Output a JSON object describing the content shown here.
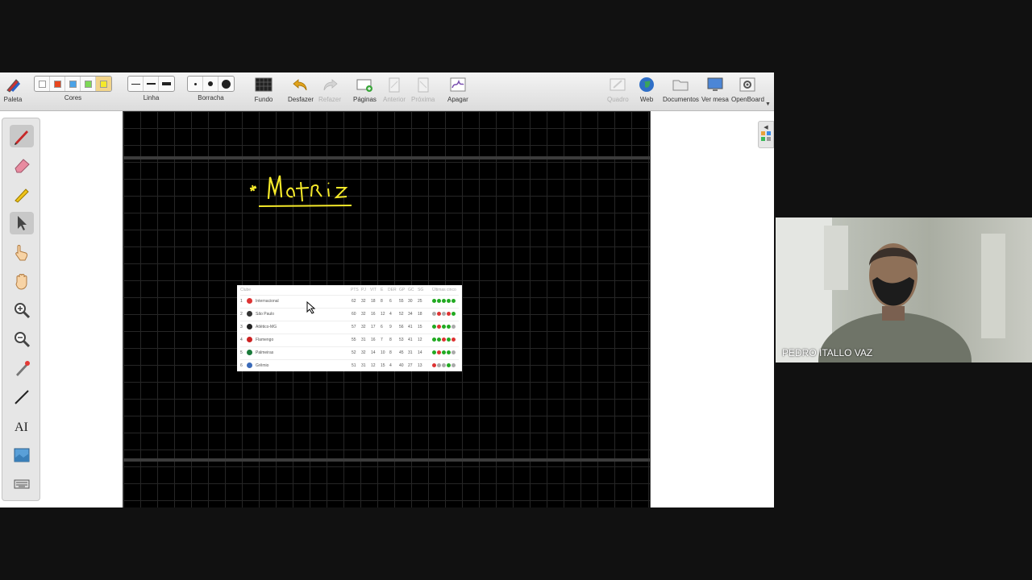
{
  "toolbar": {
    "paleta": "Paleta",
    "cores": "Cores",
    "linha": "Linha",
    "borracha": "Borracha",
    "fundo": "Fundo",
    "desfazer": "Desfazer",
    "refazer": "Refazer",
    "paginas": "Páginas",
    "anterior": "Anterior",
    "proxima": "Próxima",
    "apagar": "Apagar",
    "quadro": "Quadro",
    "web": "Web",
    "documentos": "Documentos",
    "ver_mesa": "Ver mesa",
    "openboard": "OpenBoard"
  },
  "colors": [
    "#ffffff",
    "#e8461e",
    "#4aa3e8",
    "#7ed957",
    "#f5e92a"
  ],
  "board": {
    "handwriting": "* Matriz"
  },
  "standings": {
    "header_label": "Clube",
    "header_cols": [
      "PTS",
      "PJ",
      "VIT",
      "E",
      "DER",
      "GP",
      "GC",
      "SG",
      "Últimas cinco"
    ],
    "rows": [
      {
        "pos": "1",
        "team": "Internacional",
        "badge": "#d33",
        "nums": [
          "62",
          "32",
          "18",
          "8",
          "6",
          "55",
          "30",
          "25"
        ],
        "form": [
          "#2a2",
          "#2a2",
          "#2a2",
          "#2a2",
          "#2a2"
        ]
      },
      {
        "pos": "2",
        "team": "São Paulo",
        "badge": "#333",
        "nums": [
          "60",
          "32",
          "16",
          "12",
          "4",
          "52",
          "34",
          "18"
        ],
        "form": [
          "#aaa",
          "#d33",
          "#aaa",
          "#d33",
          "#2a2"
        ]
      },
      {
        "pos": "3",
        "team": "Atlético-MG",
        "badge": "#222",
        "nums": [
          "57",
          "32",
          "17",
          "6",
          "9",
          "56",
          "41",
          "15"
        ],
        "form": [
          "#2a2",
          "#d33",
          "#2a2",
          "#2a2",
          "#aaa"
        ]
      },
      {
        "pos": "4",
        "team": "Flamengo",
        "badge": "#c22",
        "nums": [
          "55",
          "31",
          "16",
          "7",
          "8",
          "53",
          "41",
          "12"
        ],
        "form": [
          "#2a2",
          "#2a2",
          "#d33",
          "#2a2",
          "#d33"
        ]
      },
      {
        "pos": "5",
        "team": "Palmeiras",
        "badge": "#1a7a3a",
        "nums": [
          "52",
          "32",
          "14",
          "10",
          "8",
          "45",
          "31",
          "14"
        ],
        "form": [
          "#2a2",
          "#d33",
          "#2a2",
          "#2a2",
          "#aaa"
        ]
      },
      {
        "pos": "6",
        "team": "Grêmio",
        "badge": "#3a6ab8",
        "nums": [
          "51",
          "31",
          "12",
          "15",
          "4",
          "40",
          "27",
          "13"
        ],
        "form": [
          "#d33",
          "#aaa",
          "#aaa",
          "#2a2",
          "#aaa"
        ]
      }
    ]
  },
  "webcam": {
    "participant_name": "PEDRO ITALLO VAZ"
  }
}
